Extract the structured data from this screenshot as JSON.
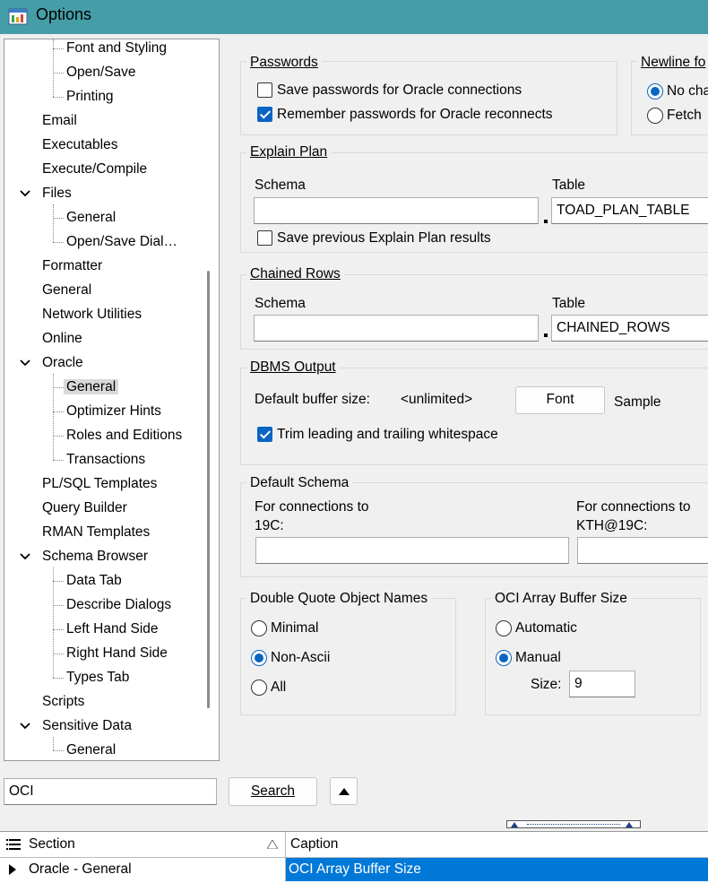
{
  "window": {
    "title": "Options"
  },
  "tree": {
    "items": [
      {
        "label": "Font and Styling",
        "level": 1
      },
      {
        "label": "Open/Save",
        "level": 1
      },
      {
        "label": "Printing",
        "level": 1
      },
      {
        "label": "Email",
        "level": 0
      },
      {
        "label": "Executables",
        "level": 0
      },
      {
        "label": "Execute/Compile",
        "level": 0
      },
      {
        "label": "Files",
        "level": 0,
        "expanded": true
      },
      {
        "label": "General",
        "level": 1
      },
      {
        "label": "Open/Save Dial…",
        "level": 1
      },
      {
        "label": "Formatter",
        "level": 0
      },
      {
        "label": "General",
        "level": 0
      },
      {
        "label": "Network Utilities",
        "level": 0
      },
      {
        "label": "Online",
        "level": 0
      },
      {
        "label": "Oracle",
        "level": 0,
        "expanded": true
      },
      {
        "label": "General",
        "level": 1,
        "selected": true
      },
      {
        "label": "Optimizer Hints",
        "level": 1
      },
      {
        "label": "Roles and Editions",
        "level": 1
      },
      {
        "label": "Transactions",
        "level": 1
      },
      {
        "label": "PL/SQL Templates",
        "level": 0
      },
      {
        "label": "Query Builder",
        "level": 0
      },
      {
        "label": "RMAN Templates",
        "level": 0
      },
      {
        "label": "Schema Browser",
        "level": 0,
        "expanded": true
      },
      {
        "label": "Data Tab",
        "level": 1
      },
      {
        "label": "Describe Dialogs",
        "level": 1
      },
      {
        "label": "Left Hand Side",
        "level": 1
      },
      {
        "label": "Right Hand Side",
        "level": 1
      },
      {
        "label": "Types Tab",
        "level": 1
      },
      {
        "label": "Scripts",
        "level": 0
      },
      {
        "label": "Sensitive Data",
        "level": 0,
        "expanded": true
      },
      {
        "label": "General",
        "level": 1
      }
    ]
  },
  "passwords": {
    "title": "Passwords",
    "save_label": "Save passwords for Oracle connections",
    "save_checked": false,
    "remember_label": "Remember passwords for Oracle reconnects",
    "remember_checked": true
  },
  "newline": {
    "title": "Newline fo",
    "opt1": "No cha",
    "opt1_selected": true,
    "opt2": "Fetch",
    "opt2_selected": false
  },
  "explain_plan": {
    "title": "Explain Plan",
    "schema_label": "Schema",
    "schema_value": "",
    "table_label": "Table",
    "table_value": "TOAD_PLAN_TABLE",
    "save_prev_label": "Save previous Explain Plan results",
    "save_prev_checked": false
  },
  "chained_rows": {
    "title": "Chained Rows",
    "schema_label": "Schema",
    "schema_value": "",
    "table_label": "Table",
    "table_value": "CHAINED_ROWS"
  },
  "dbms_output": {
    "title": "DBMS Output",
    "buffer_label": "Default buffer size:",
    "buffer_value": "<unlimited>",
    "font_button": "Font",
    "sample_label": "Sample",
    "trim_label": "Trim leading and trailing whitespace",
    "trim_checked": true
  },
  "default_schema": {
    "title": "Default Schema",
    "conn1_line1": "For connections to",
    "conn1_line2": "19C:",
    "conn1_value": "",
    "conn2_line1": "For connections to",
    "conn2_line2": "KTH@19C:",
    "conn2_value": ""
  },
  "double_quote": {
    "title": "Double Quote Object Names",
    "options": [
      "Minimal",
      "Non-Ascii",
      "All"
    ],
    "selected": "Non-Ascii"
  },
  "oci_buffer": {
    "title": "OCI Array Buffer Size",
    "opt_automatic": "Automatic",
    "opt_manual": "Manual",
    "selected": "Manual",
    "size_label": "Size:",
    "size_value": "9"
  },
  "search": {
    "value": "OCI",
    "button_label": "Search"
  },
  "results": {
    "columns": [
      "Section",
      "Caption"
    ],
    "rows": [
      {
        "section": "Oracle - General",
        "caption": "OCI Array Buffer Size"
      }
    ]
  },
  "colors": {
    "titlebar": "#459ea7",
    "accent": "#0a65c2",
    "selection": "#0078d7"
  }
}
